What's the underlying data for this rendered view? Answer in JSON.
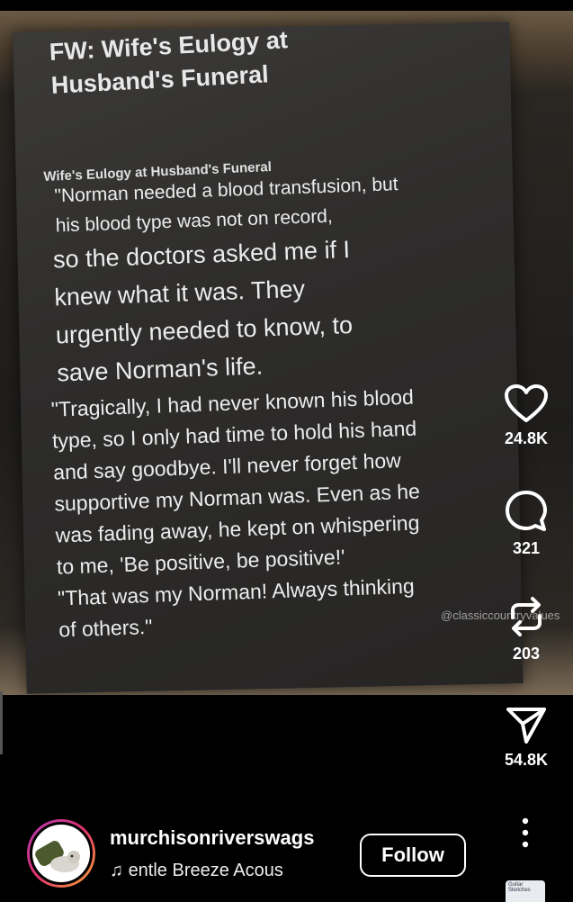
{
  "post": {
    "title": "FW: Wife's Eulogy at\nHusband's Funeral",
    "subheading": "Wife's Eulogy at Husband's Funeral",
    "lines_a": [
      "\"Norman needed a blood transfusion, but",
      "his blood type was not on record,"
    ],
    "lines_b": [
      "so the doctors asked me if I",
      "knew what it was.  They",
      "urgently needed to know, to",
      "save Norman's life."
    ],
    "lines_c": [
      "\"Tragically, I had never known his blood",
      "type, so I only had time to hold his hand",
      "and say goodbye.  I'll never forget how",
      "supportive my Norman was. Even as he",
      "was fading away, he kept on whispering",
      "to me, 'Be positive, be positive!'",
      "\"That was my Norman!  Always thinking",
      "of others.\""
    ],
    "watermark": "@classiccountryvalues"
  },
  "actions": {
    "likes": "24.8K",
    "comments": "321",
    "reposts": "203",
    "shares": "54.8K"
  },
  "author": {
    "username": "murchisonriverswags",
    "audio": "entle Breeze    Acous",
    "follow_label": "Follow"
  },
  "thumbnail": {
    "title": "Guitar Sketches"
  }
}
